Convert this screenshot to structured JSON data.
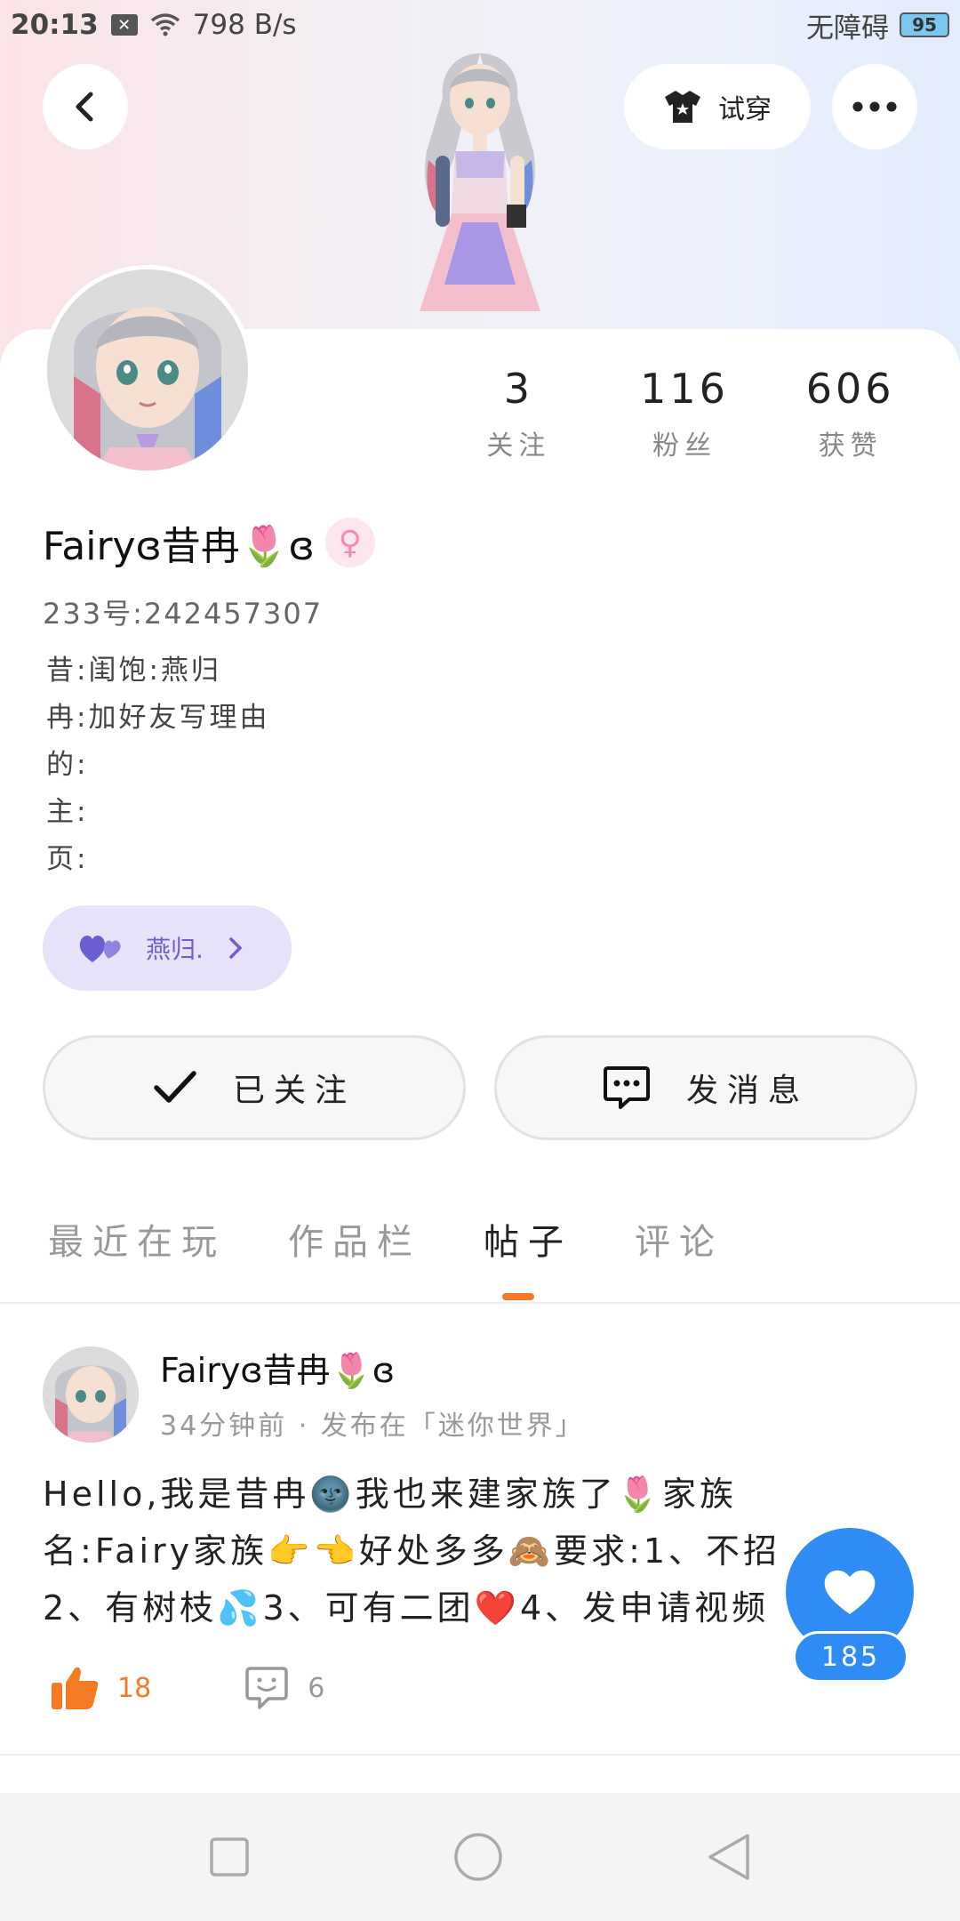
{
  "status_bar": {
    "time": "20:13",
    "network_speed": "798 B/s",
    "accessibility": "无障碍",
    "battery": "95"
  },
  "header": {
    "tryon_label": "试穿"
  },
  "stats": [
    {
      "value": "3",
      "label": "关注"
    },
    {
      "value": "116",
      "label": "粉丝"
    },
    {
      "value": "606",
      "label": "获赞"
    }
  ],
  "profile": {
    "username": "Fairyɞ昔冉🌷ɞ",
    "uid": "233号:242457307",
    "bio": [
      "昔:闺饱:燕归",
      "冉:加好友写理由",
      "的:",
      "主:",
      "页:"
    ],
    "family_chip": "燕归."
  },
  "actions": {
    "follow_label": "已关注",
    "message_label": "发消息"
  },
  "tabs": [
    "最近在玩",
    "作品栏",
    "帖子",
    "评论"
  ],
  "post": {
    "author": "Fairyɞ昔冉🌷ɞ",
    "meta": "34分钟前 · 发布在「迷你世界」",
    "lines": [
      "Hello,我是昔冉🌚我也来建家族了🌷家族",
      "名:Fairy家族👉👈好处多多🙈要求:1、不招",
      "2、有树枝💦3、可有二团❤️4、发申请视频"
    ],
    "likes": "18",
    "comments": "6"
  },
  "fab": {
    "count": "185"
  },
  "colors": {
    "accent": "#f57a24",
    "fab_blue": "#2f8cf4",
    "family_purple": "#6b5fd1"
  }
}
